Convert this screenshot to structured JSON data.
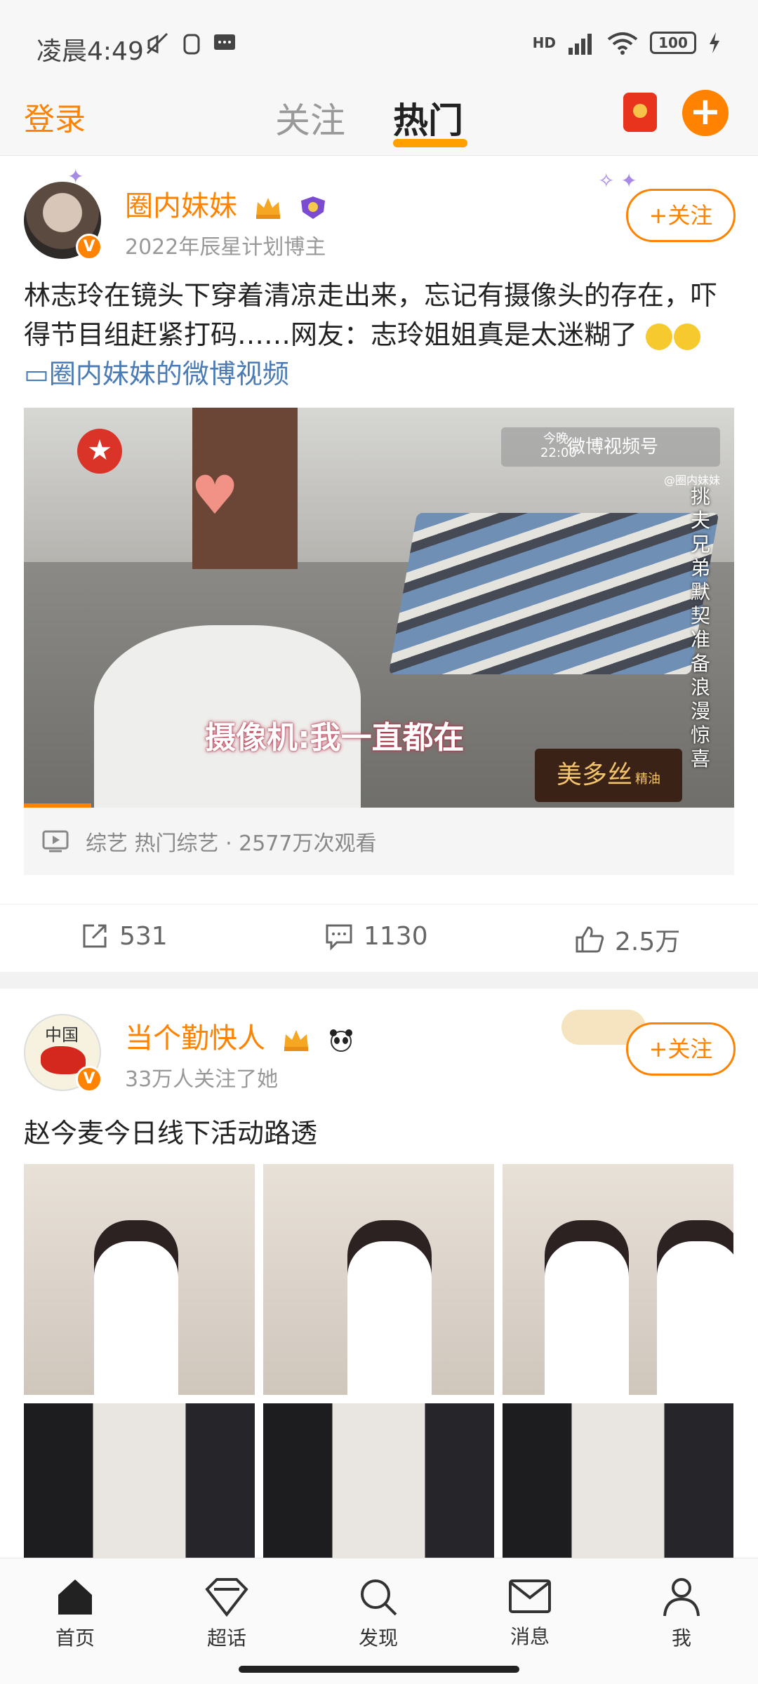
{
  "status": {
    "time": "凌晨4:49",
    "battery": "100",
    "network": "HD"
  },
  "header": {
    "login": "登录",
    "tabs": [
      {
        "label": "关注"
      },
      {
        "label": "热门"
      }
    ]
  },
  "posts": [
    {
      "user": "圈内妹妹",
      "subtitle": "2022年辰星计划博主",
      "follow": "+关注",
      "text": "林志玲在镜头下穿着清凉走出来，忘记有摄像头的存在，吓得节目组赶紧打码……网友：志玲姐姐真是太迷糊了",
      "video_link": "圈内妹妹的微博视频",
      "video": {
        "watermark": "微博视频号",
        "watermark_sub": "@圈内妹妹",
        "tonight": "今晚",
        "time": "22:00",
        "side_text": "挑夫兄弟默契准备浪漫惊喜",
        "caption": "摄像机:我一直都在",
        "ad": "美多丝",
        "ad_sub": "精油"
      },
      "meta": "综艺 热门综艺 · 2577万次观看",
      "actions": {
        "repost": "531",
        "comment": "1130",
        "like": "2.5万"
      }
    },
    {
      "user": "当个勤快人",
      "subtitle": "33万人关注了她",
      "follow": "+关注",
      "avatar_text": "中国",
      "text": "赵今麦今日线下活动路透"
    }
  ],
  "nav": [
    {
      "label": "首页"
    },
    {
      "label": "超话"
    },
    {
      "label": "发现"
    },
    {
      "label": "消息"
    },
    {
      "label": "我"
    }
  ]
}
